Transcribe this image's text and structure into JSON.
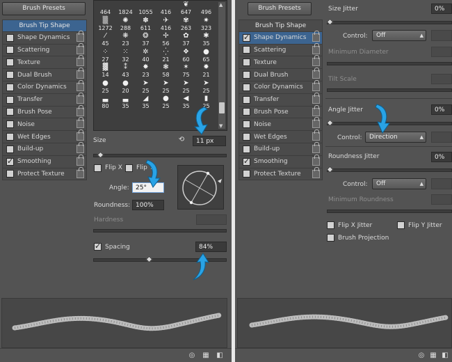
{
  "left": {
    "presets_button": "Brush Presets",
    "tabs": [
      {
        "label": "Brush Tip Shape",
        "checked": false,
        "title": true,
        "active": true
      },
      {
        "label": "Shape Dynamics",
        "checked": false
      },
      {
        "label": "Scattering",
        "checked": false
      },
      {
        "label": "Texture",
        "checked": false
      },
      {
        "label": "Dual Brush",
        "checked": false
      },
      {
        "label": "Color Dynamics",
        "checked": false
      },
      {
        "label": "Transfer",
        "checked": false
      },
      {
        "label": "Brush Pose",
        "checked": false
      },
      {
        "label": "Noise",
        "checked": false
      },
      {
        "label": "Wet Edges",
        "checked": false
      },
      {
        "label": "Build-up",
        "checked": false
      },
      {
        "label": "Smoothing",
        "checked": true
      },
      {
        "label": "Protect Texture",
        "checked": false
      }
    ],
    "brush_grid": [
      {
        "glyph": "",
        "num": "464"
      },
      {
        "glyph": "",
        "num": "1824"
      },
      {
        "glyph": "",
        "num": "1055"
      },
      {
        "glyph": "",
        "num": "416"
      },
      {
        "glyph": "❦",
        "num": "647"
      },
      {
        "glyph": "",
        "num": "496"
      },
      {
        "glyph": "▒",
        "num": "1272"
      },
      {
        "glyph": "✺",
        "num": "288"
      },
      {
        "glyph": "✽",
        "num": "611"
      },
      {
        "glyph": "✈",
        "num": "416"
      },
      {
        "glyph": "✾",
        "num": "263"
      },
      {
        "glyph": "✷",
        "num": "323"
      },
      {
        "glyph": "⁄",
        "num": "45"
      },
      {
        "glyph": "❋",
        "num": "23"
      },
      {
        "glyph": "❂",
        "num": "37"
      },
      {
        "glyph": "✢",
        "num": "56"
      },
      {
        "glyph": "✿",
        "num": "37"
      },
      {
        "glyph": "✱",
        "num": "35"
      },
      {
        "glyph": "⁘",
        "num": "27"
      },
      {
        "glyph": "⁙",
        "num": "32"
      },
      {
        "glyph": "✲",
        "num": "40"
      },
      {
        "glyph": "⁛",
        "num": "21"
      },
      {
        "glyph": "❖",
        "num": "60"
      },
      {
        "glyph": "●",
        "num": "65"
      },
      {
        "glyph": "▓",
        "num": "14"
      },
      {
        "glyph": "⁑",
        "num": "43"
      },
      {
        "glyph": "✸",
        "num": "23"
      },
      {
        "glyph": "❃",
        "num": "58"
      },
      {
        "glyph": "✶",
        "num": "75"
      },
      {
        "glyph": "✹",
        "num": "21"
      },
      {
        "glyph": "●",
        "num": "25"
      },
      {
        "glyph": "●",
        "num": "20"
      },
      {
        "glyph": "➤",
        "num": "25"
      },
      {
        "glyph": "➤",
        "num": "25"
      },
      {
        "glyph": "➤",
        "num": "25"
      },
      {
        "glyph": "➤",
        "num": "25"
      },
      {
        "glyph": "▃",
        "num": "80"
      },
      {
        "glyph": "▃",
        "num": "35"
      },
      {
        "glyph": "◢",
        "num": "35"
      },
      {
        "glyph": "●",
        "num": "25"
      },
      {
        "glyph": "◀",
        "num": "35"
      },
      {
        "glyph": "▮",
        "num": "25"
      }
    ],
    "size_label": "Size",
    "size_value": "11 px",
    "flipx_label": "Flip X",
    "flipy_label": "Flip Y",
    "angle_label": "Angle:",
    "angle_value": "25°",
    "roundness_label": "Roundness:",
    "roundness_value": "100%",
    "hardness_label": "Hardness",
    "spacing_label": "Spacing",
    "spacing_value": "84%"
  },
  "right": {
    "presets_button": "Brush Presets",
    "tabs": [
      {
        "label": "Brush Tip Shape",
        "checked": false,
        "title": true
      },
      {
        "label": "Shape Dynamics",
        "checked": true,
        "active": true
      },
      {
        "label": "Scattering",
        "checked": false
      },
      {
        "label": "Texture",
        "checked": false
      },
      {
        "label": "Dual Brush",
        "checked": false
      },
      {
        "label": "Color Dynamics",
        "checked": false
      },
      {
        "label": "Transfer",
        "checked": false
      },
      {
        "label": "Brush Pose",
        "checked": false
      },
      {
        "label": "Noise",
        "checked": false
      },
      {
        "label": "Wet Edges",
        "checked": false
      },
      {
        "label": "Build-up",
        "checked": false
      },
      {
        "label": "Smoothing",
        "checked": true
      },
      {
        "label": "Protect Texture",
        "checked": false
      }
    ],
    "size_jitter_label": "Size Jitter",
    "size_jitter_value": "0%",
    "control_label": "Control:",
    "control1_value": "Off",
    "min_diameter_label": "Minimum Diameter",
    "tilt_scale_label": "Tilt Scale",
    "angle_jitter_label": "Angle Jitter",
    "angle_jitter_value": "0%",
    "control2_value": "Direction",
    "roundness_jitter_label": "Roundness Jitter",
    "roundness_jitter_value": "0%",
    "control3_value": "Off",
    "min_roundness_label": "Minimum Roundness",
    "flipx_jitter_label": "Flip X Jitter",
    "flipy_jitter_label": "Flip Y Jitter",
    "brush_projection_label": "Brush Projection"
  },
  "icons": {
    "footer": [
      "eye-brush-icon",
      "grid-icon",
      "new-preset-icon"
    ],
    "reset": "reset-icon"
  },
  "colors": {
    "accent_arrow": "#29a3e6",
    "active_tab": "#3c6490"
  }
}
